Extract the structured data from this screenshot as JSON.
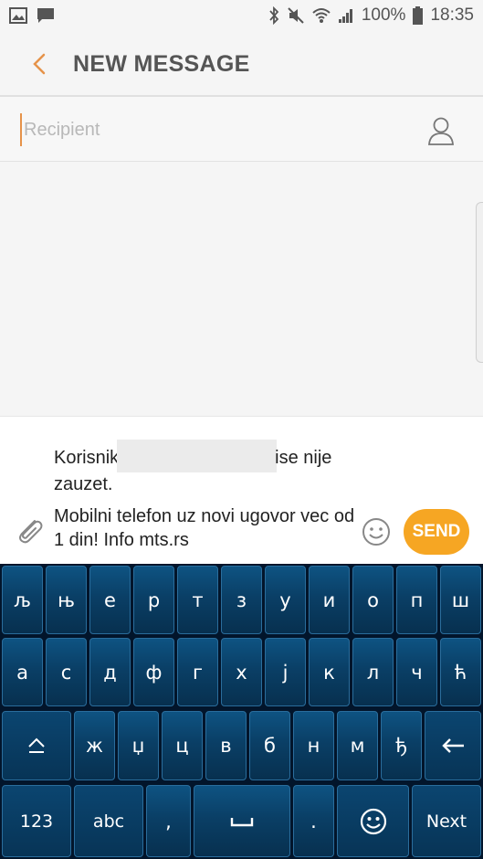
{
  "status_bar": {
    "battery": "100%",
    "time": "18:35",
    "left_icons": [
      "image-icon",
      "chat-icon"
    ],
    "right_icons": [
      "bluetooth-icon",
      "mute-icon",
      "wifi-icon",
      "signal-icon",
      "battery-icon"
    ]
  },
  "header": {
    "title": "NEW MESSAGE",
    "accent_color": "#e6934a"
  },
  "recipient": {
    "placeholder": "Recipient",
    "value": ""
  },
  "compose": {
    "line1_start": "Korisnik",
    "line1_end": "ise nije",
    "line1_next": "zauzet.",
    "line2": "Mobilni telefon uz novi ugovor vec od 1 din! Info mts.rs",
    "send_label": "SEND",
    "send_color": "#f6a623"
  },
  "keyboard": {
    "row1": [
      "љ",
      "њ",
      "е",
      "р",
      "т",
      "з",
      "у",
      "и",
      "о",
      "п",
      "ш"
    ],
    "row2": [
      "а",
      "с",
      "д",
      "ф",
      "г",
      "х",
      "ј",
      "к",
      "л",
      "ч",
      "ћ"
    ],
    "row3": [
      "ж",
      "џ",
      "ц",
      "в",
      "б",
      "н",
      "м",
      "ђ"
    ],
    "shift_icon": "shift-icon",
    "backspace_icon": "backspace-icon",
    "numbers_label": "123",
    "abc_label": "abc",
    "comma_label": ",",
    "space_icon": "space-icon",
    "period_label": ".",
    "emoji_icon": "emoji-icon",
    "next_label": "Next",
    "key_color": "#0a3f66"
  }
}
